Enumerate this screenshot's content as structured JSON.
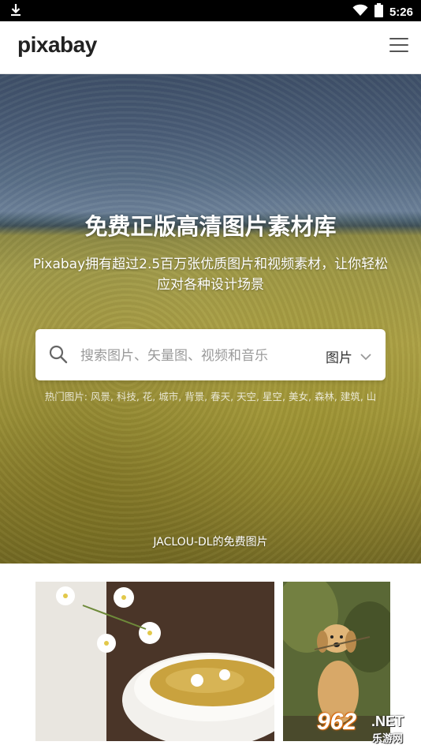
{
  "status_bar": {
    "time": "5:26",
    "icons": [
      "download-icon",
      "wifi-icon",
      "battery-icon"
    ]
  },
  "header": {
    "logo": "pixabay",
    "menu_icon": "hamburger-menu-icon"
  },
  "hero": {
    "title": "免费正版高清图片素材库",
    "subtitle": "Pixabay拥有超过2.5百万张优质图片和视频素材，让你轻松应对各种设计场景",
    "search": {
      "placeholder": "搜索图片、矢量图、视频和音乐",
      "value": "",
      "type_selected": "图片"
    },
    "popular": "热门图片: 风景, 科技, 花, 城市, 背景, 春天, 天空, 星空, 美女, 森林, 建筑, 山",
    "credit": "JACLOU-DL的免费图片"
  },
  "watermark": {
    "number": "962",
    "suffix": ".NET",
    "text": "乐游网"
  }
}
